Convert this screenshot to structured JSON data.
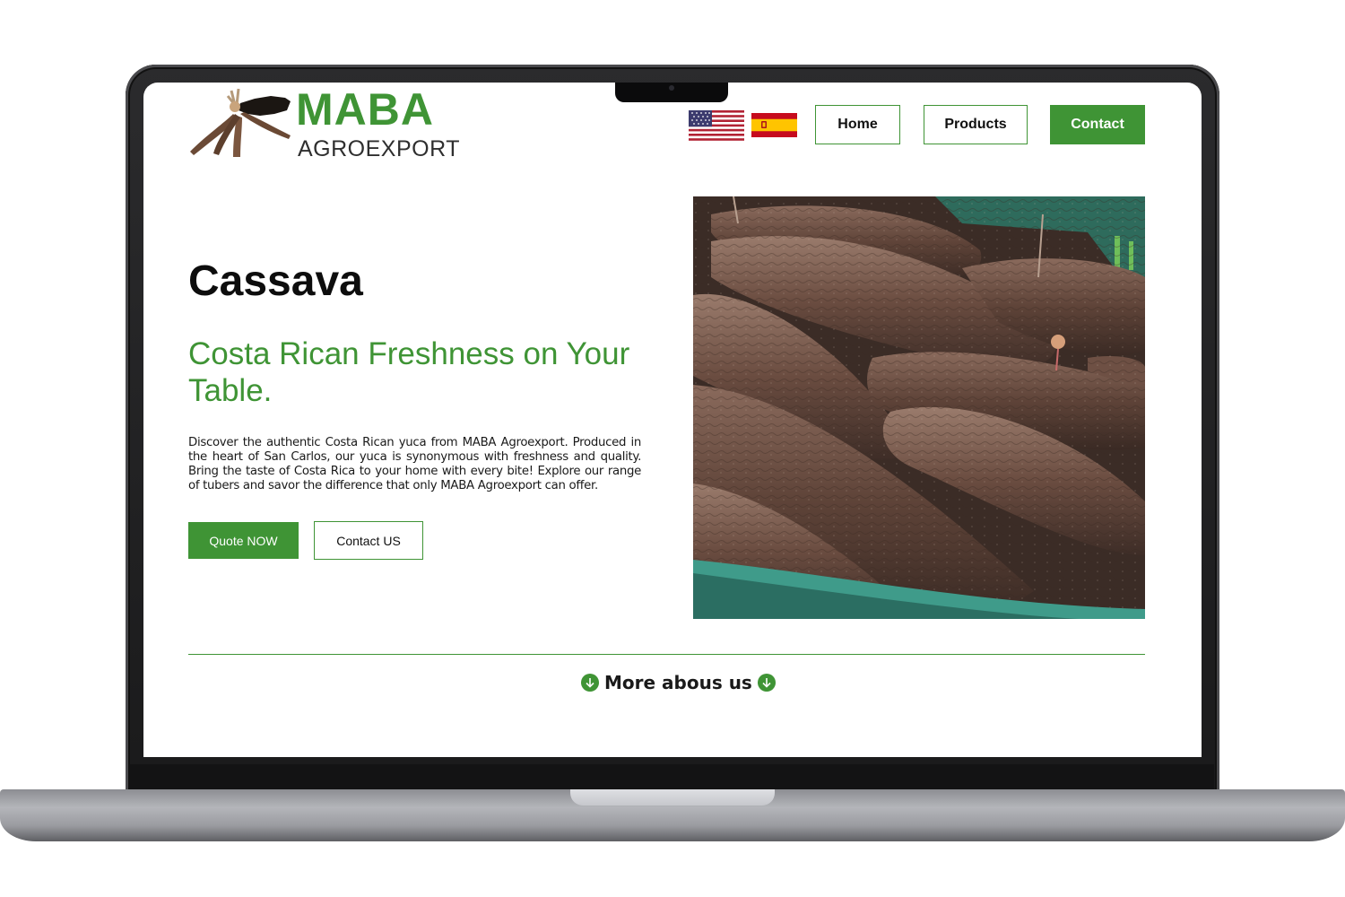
{
  "colors": {
    "brand_green": "#3f9435",
    "text_dark": "#111111",
    "laptop_frame": "#1a1a1b"
  },
  "brand": {
    "name": "MABA",
    "subtitle": "AGROEXPORT"
  },
  "language_flags": [
    {
      "icon": "us-flag-icon"
    },
    {
      "icon": "spain-flag-icon"
    }
  ],
  "nav": {
    "home": "Home",
    "products": "Products",
    "contact": "Contact"
  },
  "hero": {
    "title": "Cassava",
    "subtitle": "Costa Rican Freshness on Your Table.",
    "description": "Discover the authentic Costa Rican yuca from MABA Agroexport. Produced in the heart of San Carlos, our yuca is synonymous with freshness and quality. Bring the taste of Costa Rica to your home with every bite! Explore our range of tubers and savor the difference that only MABA Agroexport can offer.",
    "quote_button": "Quote NOW",
    "contact_button": "Contact US",
    "image_icon": "cassava-photo"
  },
  "more_section": {
    "label": "More abous us",
    "icon": "arrow-down-circle-icon"
  }
}
